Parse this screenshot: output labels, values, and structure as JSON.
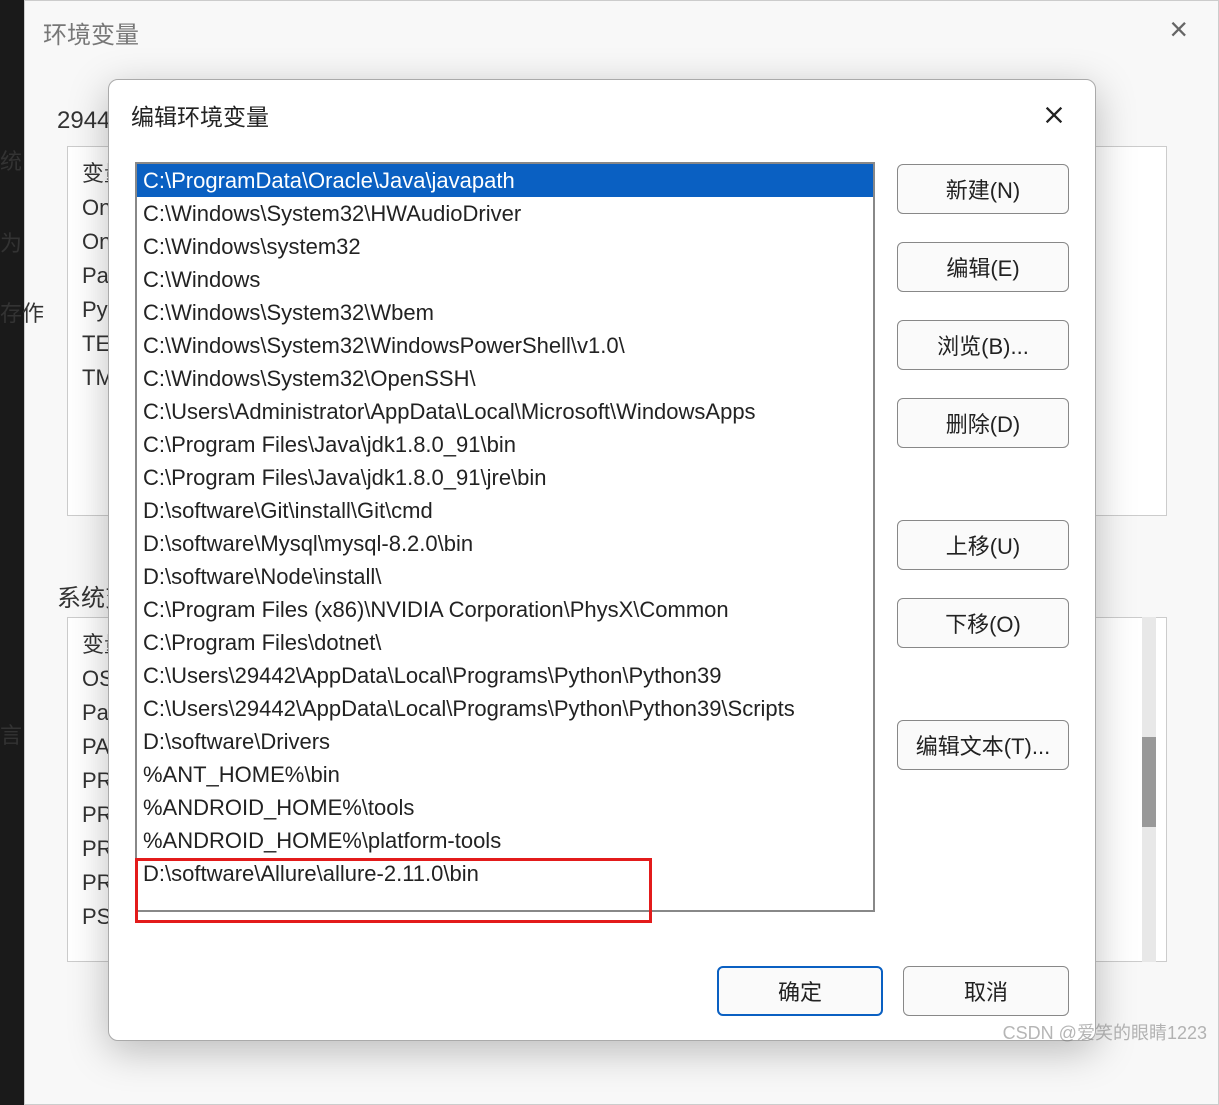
{
  "parent_dialog": {
    "title": "环境变量",
    "clip_number": "2944",
    "user_section_label": "系统变",
    "user_vars_partial": [
      "变量",
      "On",
      "On",
      "Pat",
      "PyC",
      "TEM",
      "TM"
    ],
    "sys_vars_partial": [
      "变量",
      "OS",
      "Pat",
      "PA",
      "PR",
      "PR",
      "PR",
      "PR",
      "PS"
    ]
  },
  "edge_labels": {
    "e1": "统",
    "e2": "为",
    "e3": "存作",
    "e4": "言"
  },
  "dialog": {
    "title": "编辑环境变量",
    "paths": [
      "C:\\ProgramData\\Oracle\\Java\\javapath",
      "C:\\Windows\\System32\\HWAudioDriver",
      "C:\\Windows\\system32",
      "C:\\Windows",
      "C:\\Windows\\System32\\Wbem",
      "C:\\Windows\\System32\\WindowsPowerShell\\v1.0\\",
      "C:\\Windows\\System32\\OpenSSH\\",
      "C:\\Users\\Administrator\\AppData\\Local\\Microsoft\\WindowsApps",
      "C:\\Program Files\\Java\\jdk1.8.0_91\\bin",
      "C:\\Program Files\\Java\\jdk1.8.0_91\\jre\\bin",
      "D:\\software\\Git\\install\\Git\\cmd",
      "D:\\software\\Mysql\\mysql-8.2.0\\bin",
      "D:\\software\\Node\\install\\",
      "C:\\Program Files (x86)\\NVIDIA Corporation\\PhysX\\Common",
      "C:\\Program Files\\dotnet\\",
      "C:\\Users\\29442\\AppData\\Local\\Programs\\Python\\Python39",
      "C:\\Users\\29442\\AppData\\Local\\Programs\\Python\\Python39\\Scripts",
      "D:\\software\\Drivers",
      "%ANT_HOME%\\bin",
      "%ANDROID_HOME%\\tools",
      "%ANDROID_HOME%\\platform-tools",
      "D:\\software\\Allure\\allure-2.11.0\\bin"
    ],
    "selected_index": 0,
    "buttons": {
      "new": "新建(N)",
      "edit": "编辑(E)",
      "browse": "浏览(B)...",
      "delete": "删除(D)",
      "move_up": "上移(U)",
      "move_down": "下移(O)",
      "edit_text": "编辑文本(T)...",
      "ok": "确定",
      "cancel": "取消"
    }
  },
  "watermark": "CSDN @爱笑的眼睛1223"
}
